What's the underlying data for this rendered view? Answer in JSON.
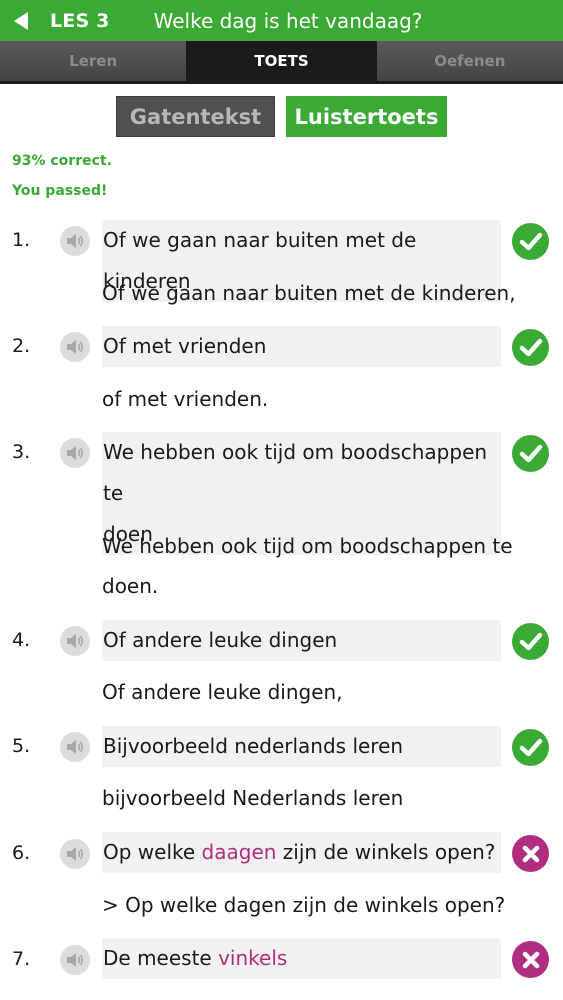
{
  "header": {
    "lesson": "LES 3",
    "title": "Welke dag is het vandaag?"
  },
  "tabs": [
    {
      "label": "Leren"
    },
    {
      "label": "TOETS"
    },
    {
      "label": "Oefenen"
    }
  ],
  "modes": {
    "gatentekst": "Gatentekst",
    "luistertoets": "Luistertoets"
  },
  "result": {
    "score": "93% correct.",
    "message": "You passed!"
  },
  "colors": {
    "green": "#3aaa35",
    "wrong": "#b02e82",
    "question_bg": "#f1f1f1"
  },
  "items": [
    {
      "num": "1.",
      "q1": "Of we gaan naar buiten met de kinderen",
      "q2": "",
      "qpre": "",
      "qwrong": "",
      "qpost": "",
      "a1": "Of we gaan naar buiten met de kinderen,",
      "a2": "",
      "correct": true
    },
    {
      "num": "2.",
      "q1": "Of met vrienden",
      "q2": "",
      "qpre": "",
      "qwrong": "",
      "qpost": "",
      "a1": "of met vrienden.",
      "a2": "",
      "correct": true
    },
    {
      "num": "3.",
      "q1": "We hebben ook tijd om boodschappen te",
      "q2": "doen",
      "qpre": "",
      "qwrong": "",
      "qpost": "",
      "a1": "We hebben ook tijd om boodschappen te",
      "a2": "doen.",
      "correct": true
    },
    {
      "num": "4.",
      "q1": "Of andere leuke dingen",
      "q2": "",
      "qpre": "",
      "qwrong": "",
      "qpost": "",
      "a1": "Of andere leuke dingen,",
      "a2": "",
      "correct": true
    },
    {
      "num": "5.",
      "q1": "Bijvoorbeeld nederlands leren",
      "q2": "",
      "qpre": "",
      "qwrong": "",
      "qpost": "",
      "a1": "bijvoorbeeld Nederlands leren",
      "a2": "",
      "correct": true
    },
    {
      "num": "6.",
      "q1": "",
      "q2": "",
      "qpre": "Op welke ",
      "qwrong": "daagen",
      "qpost": " zijn de winkels open?",
      "a1": "> Op welke dagen zijn de winkels open?",
      "a2": "",
      "correct": false
    },
    {
      "num": "7.",
      "q1": "",
      "q2": "",
      "qpre": "De meeste ",
      "qwrong": "vinkels",
      "qpost": "",
      "a1": "",
      "a2": "",
      "correct": false
    }
  ]
}
